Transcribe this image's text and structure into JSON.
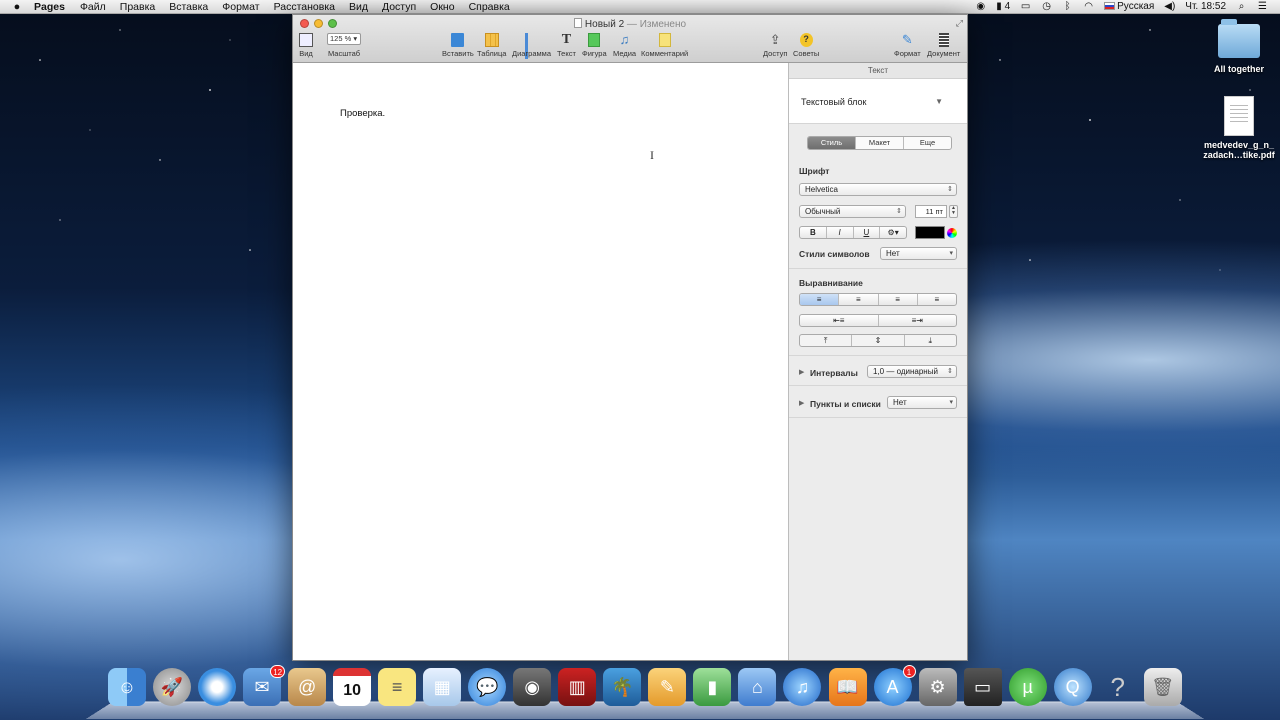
{
  "menubar": {
    "app_name": "Pages",
    "items": [
      "Файл",
      "Правка",
      "Вставка",
      "Формат",
      "Расстановка",
      "Вид",
      "Доступ",
      "Окно",
      "Справка"
    ],
    "battery_label": "4",
    "input_language": "Русская",
    "clock": "Чт. 18:52"
  },
  "desktop": {
    "folder_label": "All together",
    "pdf_label_line1": "medvedev_g_n_",
    "pdf_label_line2": "zadach…tike.pdf"
  },
  "window": {
    "title": "Новый 2",
    "title_status": "— Изменено",
    "toolbar": {
      "view_label": "Вид",
      "zoom_value": "125 %",
      "zoom_label": "Масштаб",
      "insert_label": "Вставить",
      "table_label": "Таблица",
      "chart_label": "Диаграмма",
      "text_label": "Текст",
      "shape_label": "Фигура",
      "media_label": "Медиа",
      "comment_label": "Комментарий",
      "share_label": "Доступ",
      "tips_label": "Советы",
      "format_label": "Формат",
      "document_label": "Документ"
    },
    "document_text": "Проверка."
  },
  "inspector": {
    "header": "Текст",
    "block_label": "Текстовый блок",
    "tabs": [
      "Стиль",
      "Макет",
      "Еще"
    ],
    "active_tab": 0,
    "font_section": "Шрифт",
    "font_family": "Helvetica",
    "font_style": "Обычный",
    "font_size": "11 пт",
    "style_buttons": [
      "B",
      "I",
      "U",
      "⚙▾"
    ],
    "text_color": "#000000",
    "char_styles_label": "Стили символов",
    "char_styles_value": "Нет",
    "alignment_section": "Выравнивание",
    "align_buttons": [
      "≡",
      "≡",
      "≡",
      "≡"
    ],
    "active_align": 0,
    "indent_buttons": [
      "⇤≡",
      "≡⇥"
    ],
    "vertical_buttons": [
      "⤒",
      "⇕",
      "⤓"
    ],
    "spacing_label": "Интервалы",
    "spacing_value": "1,0 — одинарный",
    "lists_label": "Пункты и списки",
    "lists_value": "Нет"
  },
  "dock": {
    "icons": [
      "finder-icon",
      "launchpad-icon",
      "safari-icon",
      "mail-icon",
      "contacts-icon",
      "calendar-icon",
      "stickies-icon",
      "preview-icon",
      "messages-icon",
      "facetime-icon",
      "photo-booth-icon",
      "iphoto-icon",
      "pages-icon",
      "numbers-icon",
      "keynote-icon",
      "itunes-icon",
      "ibooks-icon",
      "app-store-icon",
      "system-preferences-icon",
      "terminal-icon",
      "utorrent-icon",
      "quicktime-icon",
      "help-icon",
      "trash-icon"
    ],
    "mail_badge": "12",
    "calendar_day": "10",
    "appstore_badge": "1"
  }
}
